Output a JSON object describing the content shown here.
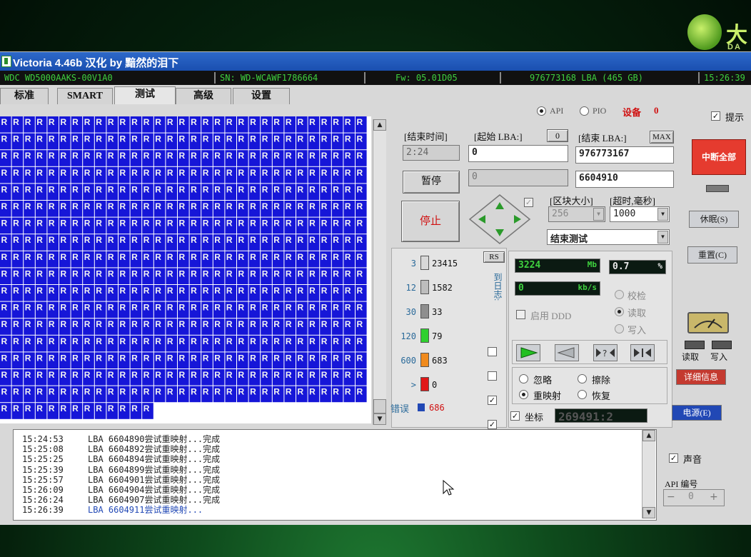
{
  "window": {
    "title": "Victoria 4.46b 汉化 by 黯然的泪下"
  },
  "drive_info": {
    "model": "WDC WD5000AAKS-00V1A0",
    "serial": "SN: WD-WCAWF1786664",
    "firmware": "Fw: 05.01D05",
    "capacity": "976773168 LBA (465 GB)",
    "clock": "15:26:39"
  },
  "tabs": [
    "标准",
    "SMART",
    "测试",
    "高级",
    "设置"
  ],
  "mode": {
    "api_label": "API",
    "pio_label": "PIO",
    "device_label": "设备",
    "device_num": "0",
    "hints_label": "提示"
  },
  "grid": {
    "cell_letter": "R",
    "cols": 31,
    "full_rows": 17,
    "last_row_cells": 13
  },
  "scan": {
    "end_time_label": "[结束时间]",
    "end_time_value": "2:24",
    "start_lba_label": "[起始 LBA:]",
    "start_lba_btn": "0",
    "start_lba_value": "0",
    "end_lba_label": "[结束 LBA:]",
    "end_lba_btn": "MAX",
    "end_lba_value": "976773167",
    "pause_label": "暂停",
    "stop_label": "停止",
    "cur_left_value": "0",
    "cur_lba_value": "6604910",
    "block_size_label": "[区块大小]",
    "timeout_label": "[超时,毫秒]",
    "block_size_value": "256",
    "timeout_value": "1000",
    "end_action_value": "结束测试"
  },
  "stats": {
    "rs_label": "RS",
    "side_label": "到日志:",
    "rows": [
      {
        "threshold": "3",
        "count": "23415",
        "color": "#d8d8d8"
      },
      {
        "threshold": "12",
        "count": "1582",
        "color": "#bdbdbd"
      },
      {
        "threshold": "30",
        "count": "33",
        "color": "#8e8e8e"
      },
      {
        "threshold": "120",
        "count": "79",
        "color": "#2fd02f"
      },
      {
        "threshold": "600",
        "count": "683",
        "color": "#f08a1c"
      },
      {
        "threshold": ">",
        "count": "0",
        "color": "#e01818"
      }
    ],
    "error_label": "错误",
    "error_count": "686"
  },
  "perf": {
    "size_value": "3224",
    "size_unit": "Mb",
    "percent_value": "0.7",
    "percent_unit": "%",
    "speed_value": "0",
    "speed_unit": "kb/s",
    "ddd_label": "启用 DDD",
    "verify_label": "校检",
    "read_label": "读取",
    "write_label": "写入",
    "ignore_label": "忽略",
    "erase_label": "擦除",
    "remap_label": "重映射",
    "restore_label": "恢复",
    "coord_label": "坐标",
    "coord_value": "269491:2"
  },
  "side": {
    "break_all": "中断全部",
    "sleep": "休眠(S)",
    "reset": "重置(C)",
    "read": "读取",
    "write": "写入",
    "details": "详细信息",
    "power": "电源(E)",
    "sound": "声音",
    "api_num_label": "API 编号",
    "api_num_value": "0"
  },
  "log": [
    {
      "time": "15:24:53",
      "text": "LBA 6604890尝试重映射...完成"
    },
    {
      "time": "15:25:08",
      "text": "LBA 6604892尝试重映射...完成"
    },
    {
      "time": "15:25:25",
      "text": "LBA 6604894尝试重映射...完成"
    },
    {
      "time": "15:25:39",
      "text": "LBA 6604899尝试重映射...完成"
    },
    {
      "time": "15:25:57",
      "text": "LBA 6604901尝试重映射...完成"
    },
    {
      "time": "15:26:09",
      "text": "LBA 6604904尝试重映射...完成"
    },
    {
      "time": "15:26:24",
      "text": "LBA 6604907尝试重映射...完成"
    },
    {
      "time": "15:26:39",
      "text": "LBA 6604911尝试重映射..."
    }
  ]
}
